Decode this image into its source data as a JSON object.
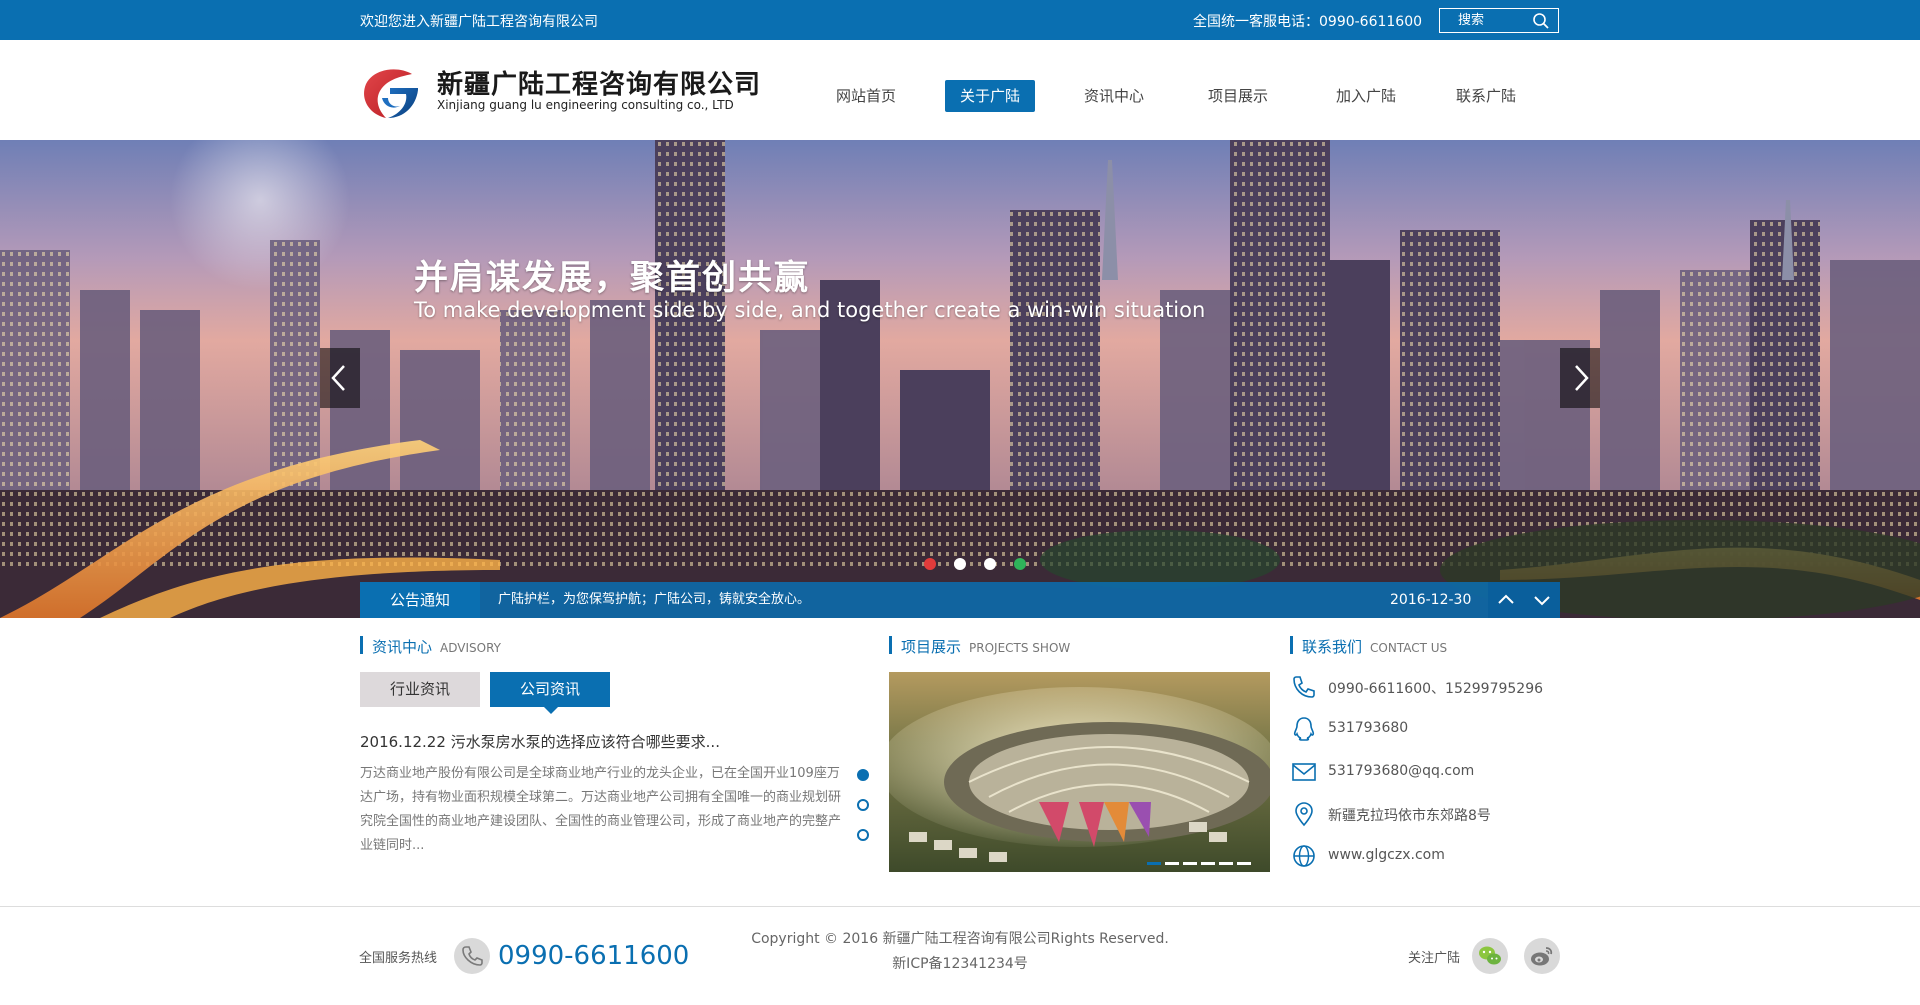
{
  "topbar": {
    "welcome": "欢迎您进入新疆广陆工程咨询有限公司",
    "hotline": "全国统一客服电话：0990-6611600",
    "search_placeholder": "搜索"
  },
  "header": {
    "company_cn": "新疆广陆工程咨询有限公司",
    "company_en": "Xinjiang guang lu engineering consulting co., LTD"
  },
  "nav": [
    {
      "label": "网站首页",
      "active": false
    },
    {
      "label": "关于广陆",
      "active": true
    },
    {
      "label": "资讯中心",
      "active": false
    },
    {
      "label": "项目展示",
      "active": false
    },
    {
      "label": "加入广陆",
      "active": false
    },
    {
      "label": "联系广陆",
      "active": false
    }
  ],
  "banner": {
    "title": "并肩谋发展，聚首创共赢",
    "subtitle": "To make development side by side, and together create a win-win situation"
  },
  "notice": {
    "label": "公告通知",
    "text": "广陆护栏，为您保驾护航；广陆公司，铸就安全放心。",
    "date": "2016-12-30"
  },
  "news": {
    "section_cn": "资讯中心",
    "section_en": "ADVISORY",
    "tabs": [
      "行业资讯",
      "公司资讯"
    ],
    "active_tab": 1,
    "title": "2016.12.22 污水泵房水泵的选择应该符合哪些要求...",
    "body": "万达商业地产股份有限公司是全球商业地产行业的龙头企业，已在全国开业109座万达广场，持有物业面积规模全球第二。万达商业地产公司拥有全国唯一的商业规划研究院全国性的商业地产建设团队、全国性的商业管理公司，形成了商业地产的完整产业链同时..."
  },
  "projects": {
    "section_cn": "项目展示",
    "section_en": "PROJECTS SHOW"
  },
  "contact": {
    "section_cn": "联系我们",
    "section_en": "CONTACT US",
    "items": [
      {
        "icon": "phone-icon",
        "text": "0990-6611600、15299795296"
      },
      {
        "icon": "qq-icon",
        "text": "531793680"
      },
      {
        "icon": "mail-icon",
        "text": "531793680@qq.com"
      },
      {
        "icon": "location-icon",
        "text": "新疆克拉玛依市东郊路8号"
      },
      {
        "icon": "globe-icon",
        "text": "www.glgczx.com"
      }
    ]
  },
  "footer": {
    "hotline_label": "全国服务热线",
    "hotline_number": "0990-6611600",
    "copyright": "Copyright © 2016 新疆广陆工程咨询有限公司Rights Reserved.",
    "icp": "新ICP备12341234号",
    "follow_label": "关注广陆"
  },
  "colors": {
    "brand_blue": "#0a6fb1",
    "tab_gray": "#ddd9db",
    "footer_icon_gray": "#d9d9d9"
  }
}
